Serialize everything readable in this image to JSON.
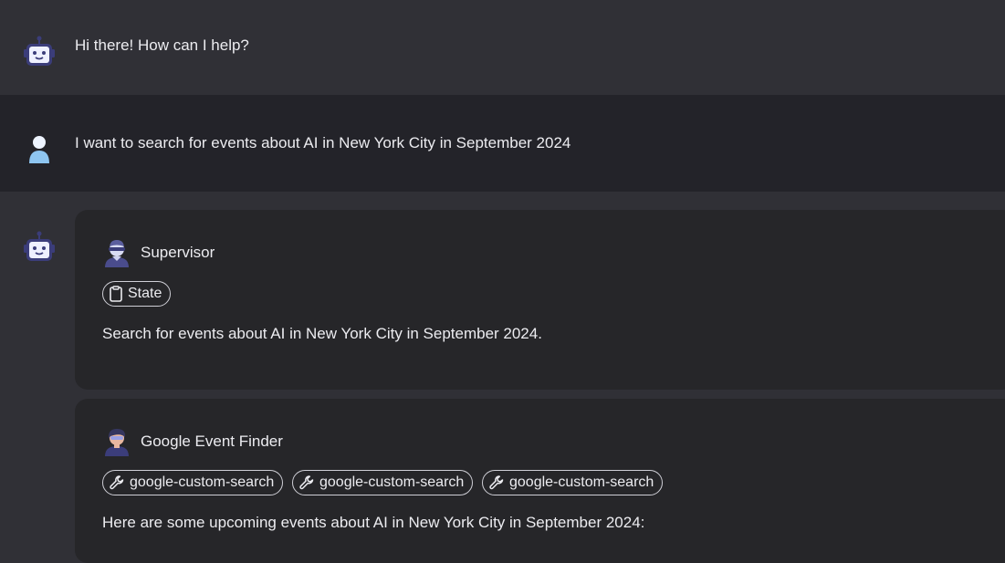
{
  "conversation": {
    "bot_greeting": "Hi there! How can I help?",
    "user_message": "I want to search for events about AI in New York City in September 2024",
    "bot_icon": "robot-icon",
    "user_icon": "person-icon"
  },
  "steps": [
    {
      "agent_name": "Supervisor",
      "agent_icon": "supervisor-avatar",
      "chips": [
        {
          "label": "State",
          "icon": "clipboard-icon"
        }
      ],
      "text": "Search for events about AI in New York City in September 2024."
    },
    {
      "agent_name": "Google Event Finder",
      "agent_icon": "event-finder-avatar",
      "chips": [
        {
          "label": "google-custom-search",
          "icon": "wrench-icon"
        },
        {
          "label": "google-custom-search",
          "icon": "wrench-icon"
        },
        {
          "label": "google-custom-search",
          "icon": "wrench-icon"
        }
      ],
      "text": "Here are some upcoming events about AI in New York City in September 2024:"
    }
  ],
  "colors": {
    "bot_row": "#303036",
    "user_row": "#232329",
    "card": "#262629",
    "robot_purple": "#3b3d7a",
    "user_blue": "#8ec5f0"
  }
}
